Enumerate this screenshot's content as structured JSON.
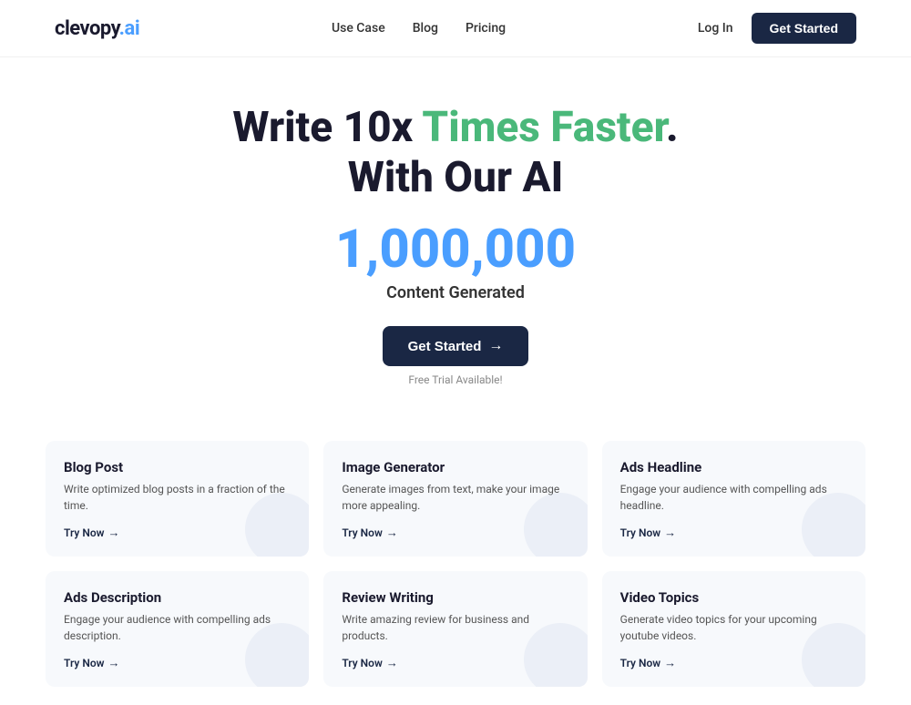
{
  "nav": {
    "logo_text": "clevopy.ai",
    "logo_dot": "",
    "links": [
      {
        "label": "Use Case",
        "id": "use-case"
      },
      {
        "label": "Blog",
        "id": "blog"
      },
      {
        "label": "Pricing",
        "id": "pricing"
      }
    ],
    "login_label": "Log In",
    "cta_label": "Get Started"
  },
  "hero": {
    "title_part1": "Write 10x ",
    "title_highlight": "Times Faster",
    "title_part2": ".",
    "title_line2": "With Our AI",
    "count": "1,000,000",
    "subtitle": "Content Generated",
    "btn_label": "Get Started",
    "btn_arrow": "→",
    "trial_text": "Free Trial Available!"
  },
  "cards": [
    {
      "id": "blog-post",
      "title": "Blog Post",
      "desc": "Write optimized blog posts in a fraction of the time.",
      "link": "Try Now",
      "arrow": "→"
    },
    {
      "id": "image-generator",
      "title": "Image Generator",
      "desc": "Generate images from text, make your image more appealing.",
      "link": "Try Now",
      "arrow": "→"
    },
    {
      "id": "ads-headline",
      "title": "Ads Headline",
      "desc": "Engage your audience with compelling ads headline.",
      "link": "Try Now",
      "arrow": "→"
    },
    {
      "id": "ads-description",
      "title": "Ads Description",
      "desc": "Engage your audience with compelling ads description.",
      "link": "Try Now",
      "arrow": "→"
    },
    {
      "id": "review-writing",
      "title": "Review Writing",
      "desc": "Write amazing review for business and products.",
      "link": "Try Now",
      "arrow": "→"
    },
    {
      "id": "video-topics",
      "title": "Video Topics",
      "desc": "Generate video topics for your upcoming youtube videos.",
      "link": "Try Now",
      "arrow": "→"
    }
  ]
}
